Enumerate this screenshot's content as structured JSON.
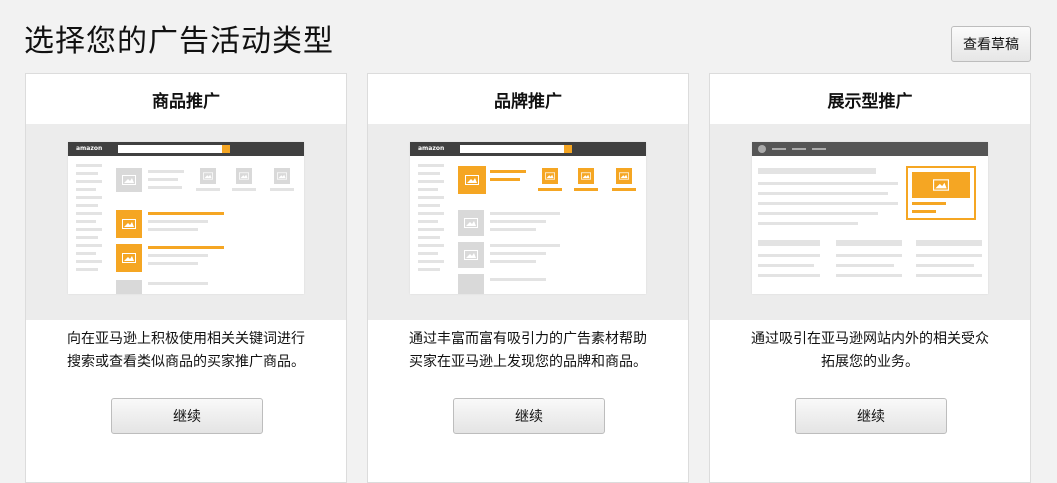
{
  "page": {
    "title": "选择您的广告活动类型",
    "draft_button": "查看草稿"
  },
  "colors": {
    "accent": "#f5a623",
    "placeholder_gray": "#d9d9d9",
    "nav_dark": "#404040"
  },
  "cards": [
    {
      "title": "商品推广",
      "logo": "amazon",
      "description_lines": [
        "向在亚马逊上积极使用相关关键词进行",
        "搜索或查看类似商品的买家推广商品。"
      ],
      "button": "继续"
    },
    {
      "title": "品牌推广",
      "logo": "amazon",
      "description_lines": [
        "通过丰富而富有吸引力的广告素材帮助",
        "买家在亚马逊上发现您的品牌和商品。"
      ],
      "button": "继续"
    },
    {
      "title": "展示型推广",
      "description_lines": [
        "通过吸引在亚马逊网站内外的相关受众",
        "拓展您的业务。"
      ],
      "button": "继续"
    }
  ]
}
